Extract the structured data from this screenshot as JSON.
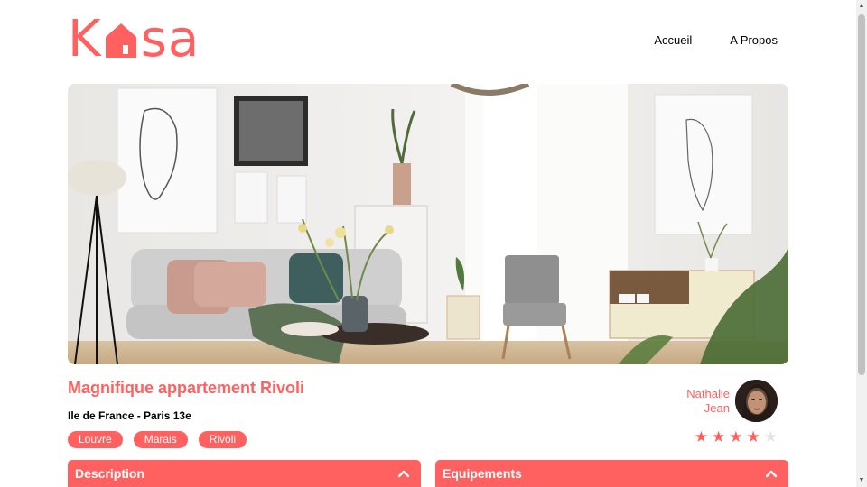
{
  "brand": {
    "logo_k": "K",
    "logo_sa": "sa",
    "color": "#FF6060"
  },
  "nav": {
    "home": "Accueil",
    "about": "A Propos"
  },
  "listing": {
    "title": "Magnifique appartement Rivoli",
    "location": "Ile de France - Paris 13e",
    "tags": [
      "Louvre",
      "Marais",
      "Rivoli"
    ]
  },
  "host": {
    "first_name": "Nathalie",
    "last_name": "Jean"
  },
  "rating": {
    "value": 4,
    "max": 5
  },
  "sections": {
    "description": "Description",
    "equipments": "Equipements"
  },
  "icons": {
    "collapse": "chevron-up-icon",
    "star": "star-icon",
    "logo_house": "house-icon"
  }
}
